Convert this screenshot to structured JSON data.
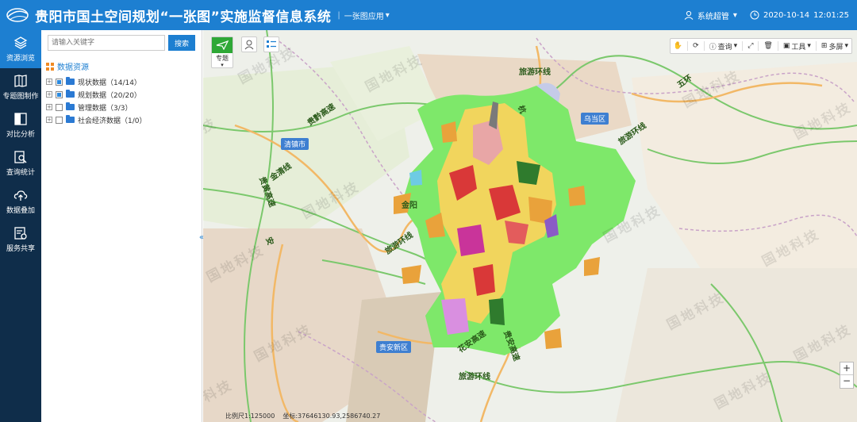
{
  "header": {
    "title": "贵阳市国土空间规划“一张图”实施监督信息系统",
    "app_menu_label": "一张图应用",
    "user_label": "系统超管",
    "date": "2020-10-14",
    "time": "12:01:25"
  },
  "nav": {
    "items": [
      {
        "label": "资源浏览",
        "icon": "layers-icon"
      },
      {
        "label": "专题图制作",
        "icon": "map-book-icon"
      },
      {
        "label": "对比分析",
        "icon": "split-view-icon"
      },
      {
        "label": "查询统计",
        "icon": "search-doc-icon"
      },
      {
        "label": "数据叠加",
        "icon": "cloud-upload-icon"
      },
      {
        "label": "服务共享",
        "icon": "service-share-icon"
      }
    ]
  },
  "panel": {
    "search_placeholder": "请输入关键字",
    "search_button": "搜索",
    "tree_root": "数据资源",
    "tree_items": [
      {
        "label": "现状数据（14/14）",
        "checked": "partial"
      },
      {
        "label": "规划数据（20/20）",
        "checked": "partial"
      },
      {
        "label": "管理数据（3/3）",
        "checked": "none"
      },
      {
        "label": "社会经济数据（1/0）",
        "checked": "none"
      }
    ]
  },
  "map": {
    "thematic_label": "专题",
    "toolbar": {
      "query": "查询",
      "tools": "工具",
      "multi_screen": "多屏"
    },
    "places": {
      "qingzhen": "清镇市",
      "wudang": "乌当区",
      "guian": "贵安新区"
    },
    "roads": {
      "lvyou_n": "旅游环线",
      "lvyou_w": "旅游环线",
      "lvyou_e": "旅游环线",
      "lvyou_s": "旅游环线",
      "guiqian": "贵黔高速",
      "jinqing": "金清线",
      "jinyang": "金阳",
      "huaan": "花安高速",
      "guihuang": "贵黄高速",
      "guian_hw": "贵安高速",
      "wuhuan": "五环",
      "hang": "杭",
      "an": "安"
    },
    "watermark": "国地科技",
    "scale_label": "比例尺1:125000",
    "coord_label": "坐标:37646130.93,2586740.27"
  },
  "colors": {
    "header_bg": "#1d7fd1",
    "nav_bg": "#0f2d4a",
    "nav_active": "#1d7fd1",
    "green_zone": "#7ee86a"
  }
}
